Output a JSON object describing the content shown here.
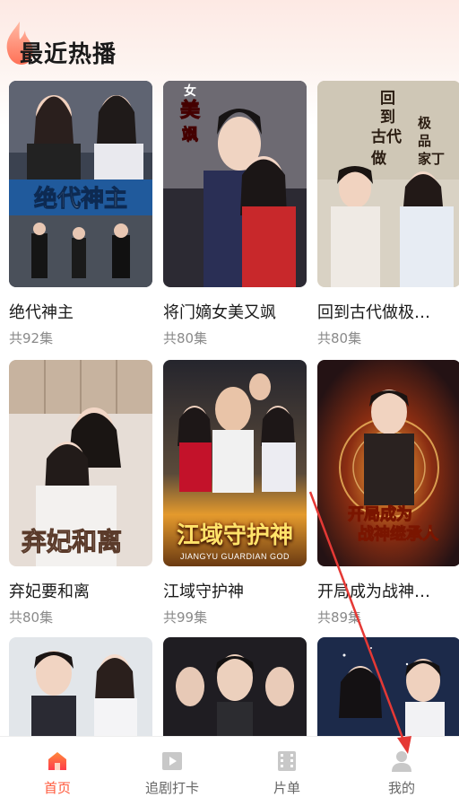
{
  "section": {
    "title": "最近热播",
    "icon": "flame-icon"
  },
  "dramas": [
    {
      "title": "绝代神主",
      "episodes": "共92集"
    },
    {
      "title": "将门嫡女美又飒",
      "episodes": "共80集"
    },
    {
      "title": "回到古代做极…",
      "episodes": "共80集"
    },
    {
      "title": "弃妃要和离",
      "episodes": "共80集"
    },
    {
      "title": "江域守护神",
      "episodes": "共99集",
      "poster_caption": "江域守护神",
      "poster_subtitle": "JIANGYU GUARDIAN GOD"
    },
    {
      "title": "开局成为战神…",
      "episodes": "共89集"
    }
  ],
  "tabbar": {
    "tabs": [
      {
        "label": "首页",
        "icon": "home-icon",
        "active": true
      },
      {
        "label": "追剧打卡",
        "icon": "play-icon",
        "active": false
      },
      {
        "label": "片单",
        "icon": "film-list-icon",
        "active": false
      },
      {
        "label": "我的",
        "icon": "person-icon",
        "active": false
      }
    ]
  },
  "colors": {
    "accent": "#ff5a3c",
    "annotation_arrow": "#e53935"
  }
}
